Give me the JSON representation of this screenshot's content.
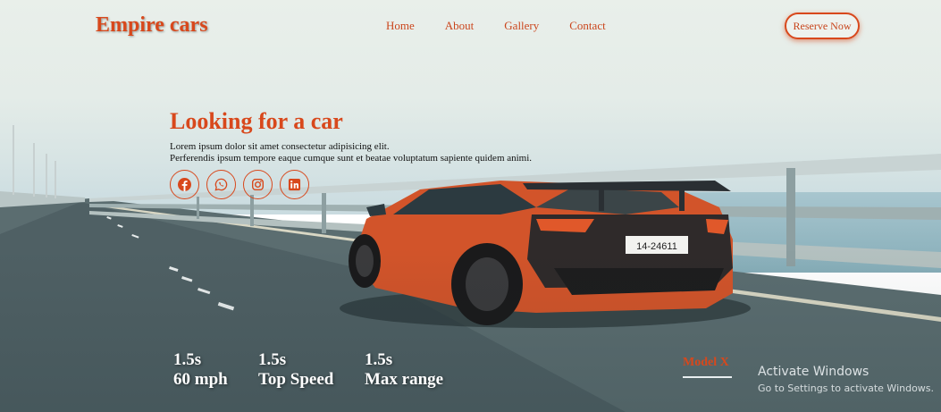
{
  "brand": {
    "name": "Empire cars"
  },
  "nav": {
    "items": [
      "Home",
      "About",
      "Gallery",
      "Contact"
    ],
    "cta": "Reserve Now"
  },
  "hero": {
    "title": "Looking for a car",
    "line1": "Lorem ipsum dolor sit amet consectetur adipisicing elit.",
    "line2": "Perferendis ipsum tempore eaque cumque sunt et beatae voluptatum sapiente quidem animi."
  },
  "socials": [
    "facebook-icon",
    "whatsapp-icon",
    "instagram-icon",
    "linkedin-icon"
  ],
  "stats": [
    {
      "value": "1.5s",
      "label": "60 mph"
    },
    {
      "value": "1.5s",
      "label": "Top Speed"
    },
    {
      "value": "1.5s",
      "label": "Max range"
    }
  ],
  "model": {
    "label": "Model X"
  },
  "windows_watermark": {
    "title": "Activate Windows",
    "subtitle": "Go to Settings to activate Windows."
  },
  "colors": {
    "accent": "#d8481c",
    "car_body": "#d2542a"
  }
}
